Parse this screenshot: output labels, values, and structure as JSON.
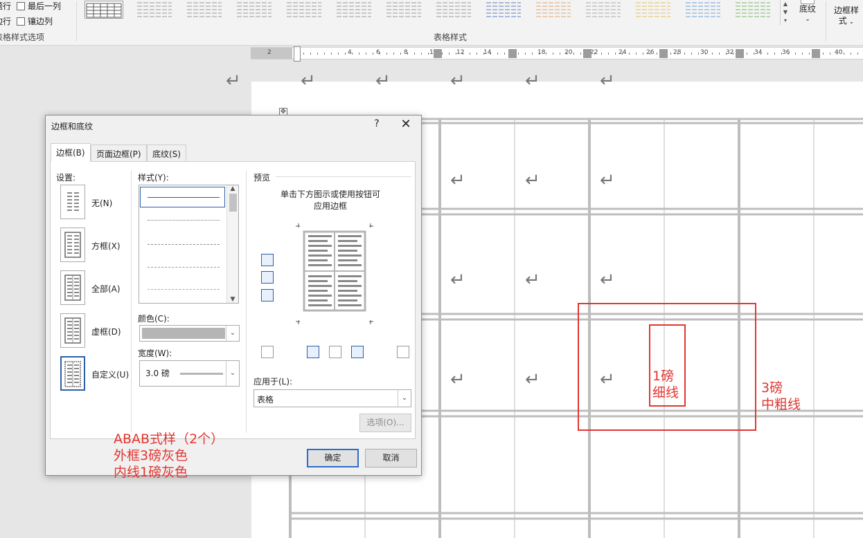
{
  "ribbon": {
    "options": [
      "最后一列",
      "镶边列"
    ],
    "options_left": [
      "题行",
      "边行"
    ],
    "style_options_group": "表格样式选项",
    "table_styles_group": "表格样式",
    "shading_label": "底纹",
    "border_style_label_1": "边框样",
    "border_style_label_2": "式"
  },
  "ruler": {
    "labels": [
      "2",
      "4",
      "6",
      "8",
      "10",
      "12",
      "14",
      "18",
      "20",
      "22",
      "24",
      "26",
      "28",
      "30",
      "32",
      "34",
      "36",
      "40"
    ]
  },
  "document": {
    "paragraph_mark": "↵"
  },
  "dialog": {
    "title": "边框和底纹",
    "help": "?",
    "close": "✕",
    "tabs": [
      "边框(B)",
      "页面边框(P)",
      "底纹(S)"
    ],
    "setting_label": "设置:",
    "settings": [
      "无(N)",
      "方框(X)",
      "全部(A)",
      "虚框(D)",
      "自定义(U)"
    ],
    "style_label": "样式(Y):",
    "color_label": "颜色(C):",
    "width_label": "宽度(W):",
    "width_value": "3.0 磅",
    "preview_label": "预览",
    "preview_hint_1": "单击下方图示或使用按钮可",
    "preview_hint_2": "应用边框",
    "apply_label": "应用于(L):",
    "apply_value": "表格",
    "options_button": "选项(O)...",
    "ok_button": "确定",
    "cancel_button": "取消"
  },
  "annotations": {
    "dialog_note": [
      "ABAB式样（2个）",
      "外框3磅灰色",
      "内线1磅灰色"
    ],
    "thin_note": [
      "1磅",
      "细线"
    ],
    "thick_note": [
      "3磅",
      "中粗线"
    ]
  },
  "colors": {
    "annotation": "#e3342f",
    "table_border": "#bdbdbd",
    "accent": "#2b5fa8"
  }
}
